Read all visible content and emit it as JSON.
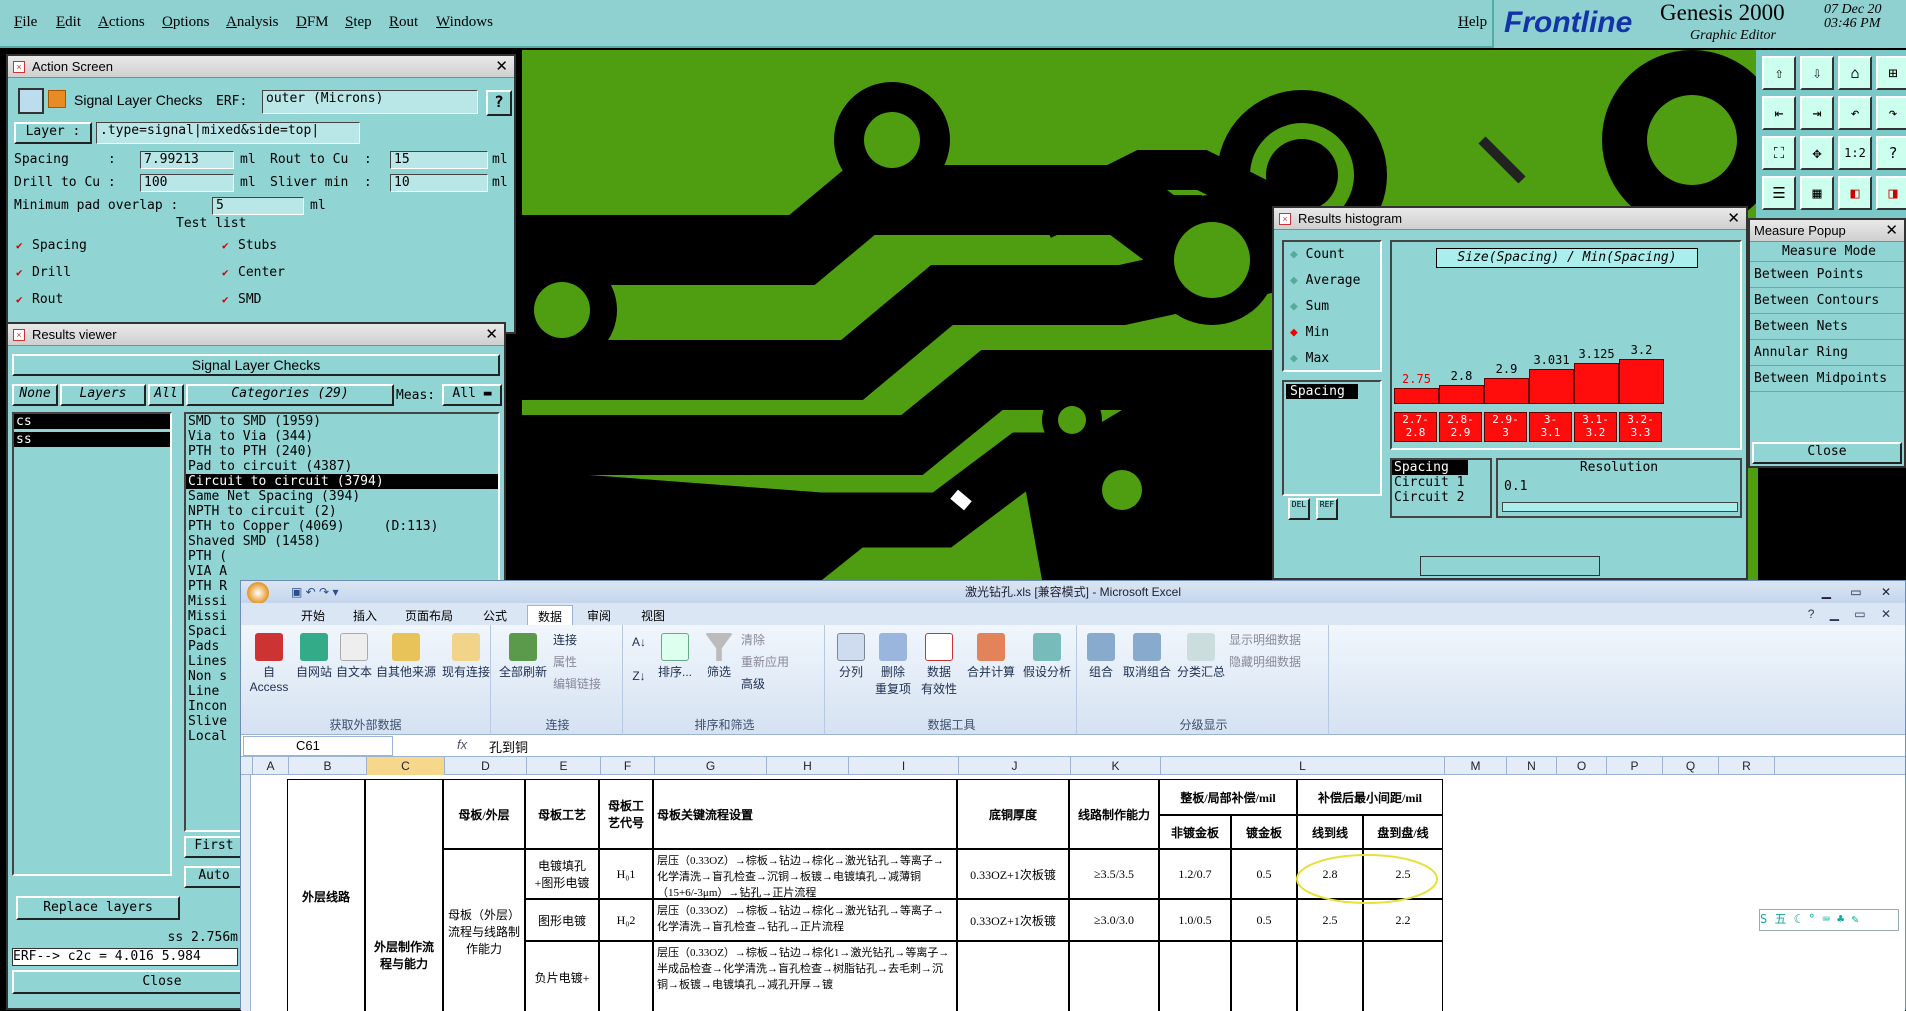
{
  "menu": [
    "File",
    "Edit",
    "Actions",
    "Options",
    "Analysis",
    "DFM",
    "Step",
    "Rout",
    "Windows"
  ],
  "help": "Help",
  "brand": {
    "logo": "Frontline",
    "product": "Genesis 2000",
    "subtitle": "Graphic Editor",
    "date": "07 Dec 20",
    "time": "03:46 PM"
  },
  "action_screen": {
    "title": "Action Screen",
    "check_name": "Signal Layer Checks",
    "erf_label": "ERF:",
    "erf_value": "outer (Microns)",
    "layer_label": "Layer :",
    "layer_value": ".type=signal|mixed&side=top|",
    "spacing_label": "Spacing     :",
    "spacing_value": "7.99213",
    "rout_label": "Rout to Cu  :",
    "rout_value": "15",
    "drill_label": "Drill to Cu :",
    "drill_value": "100",
    "sliver_label": "Sliver min  :",
    "sliver_value": "10",
    "unit": "ml",
    "minpad_label": "Minimum pad overlap :",
    "minpad_value": "5",
    "testlist_label": "Test list",
    "tests": [
      "Spacing",
      "Drill",
      "Rout",
      "Stubs",
      "Center",
      "SMD"
    ]
  },
  "results_viewer": {
    "title": "Results viewer",
    "header": "Signal Layer Checks",
    "none": "None",
    "layers": "Layers",
    "all": "All",
    "categories": "Categories (29)",
    "meas_label": "Meas:",
    "meas_value": "All",
    "layer_items": [
      "cs",
      "ss"
    ],
    "category_items": [
      "SMD to SMD (1959)",
      "Via to Via (344)",
      "PTH to PTH (240)",
      "Pad to circuit (4387)",
      "Circuit to circuit (3794)",
      "Same Net Spacing (394)",
      "NPTH to circuit (2)",
      "PTH to Copper (4069)     (D:113)",
      "Shaved SMD (1458)",
      "PTH (",
      "VIA A",
      "PTH R",
      "Missi",
      "Missi",
      "Spaci",
      "Pads",
      "Lines",
      "Non s",
      "Line",
      "Incon",
      "Slive",
      "Local"
    ],
    "replace_layers": "Replace layers",
    "first": "First",
    "auto": "Auto",
    "status1": "ss 2.756m",
    "status2": "ERF--> c2c = 4.016 5.984",
    "close": "Close"
  },
  "histogram": {
    "title": "Results histogram",
    "options": [
      "Count",
      "Average",
      "Sum",
      "Min",
      "Max"
    ],
    "selected_option": "Min",
    "metric_label": "Spacing",
    "header": "Size(Spacing) / Min(Spacing)",
    "legend": [
      "Spacing",
      "Circuit 1",
      "Circuit 2"
    ],
    "resolution_label": "Resolution",
    "resolution_value": "0.1",
    "del": "DEL",
    "ref": "REF"
  },
  "chart_data": {
    "type": "bar",
    "title": "Size(Spacing) / Min(Spacing)",
    "categories": [
      "2.7-2.8",
      "2.8-2.9",
      "2.9-3",
      "3-3.1",
      "3.1-3.2",
      "3.2-3.3"
    ],
    "values": [
      2.75,
      2.8,
      2.9,
      3.031,
      3.125,
      3.2
    ],
    "value_labels": [
      "2.75",
      "2.8",
      "2.9",
      "3.031",
      "3.125",
      "3.2"
    ],
    "range_labels": [
      [
        "2.7-",
        "2.8"
      ],
      [
        "2.8-",
        "2.9"
      ],
      [
        "2.9-",
        "3"
      ],
      [
        "3-",
        "3.1"
      ],
      [
        "3.1-",
        "3.2"
      ],
      [
        "3.2-",
        "3.3"
      ]
    ],
    "ylim": [
      2.5,
      3.3
    ]
  },
  "measure_popup": {
    "title": "Measure Popup",
    "mode": "Measure Mode",
    "items": [
      "Between Points",
      "Between Contours",
      "Between Nets",
      "Annular Ring",
      "Between Midpoints"
    ],
    "close": "Close"
  },
  "excel": {
    "title": "激光钻孔.xls [兼容模式] - Microsoft Excel",
    "tabs": [
      "开始",
      "插入",
      "页面布局",
      "公式",
      "数据",
      "审阅",
      "视图"
    ],
    "active_tab": "数据",
    "groups": [
      "获取外部数据",
      "连接",
      "排序和筛选",
      "数据工具",
      "分级显示"
    ],
    "buttons": {
      "access": "自 Access",
      "web": "自网站",
      "text": "自文本",
      "other": "自其他来源",
      "existing": "现有连接",
      "refresh": "全部刷新",
      "connections": "连接",
      "properties": "属性",
      "editlinks": "编辑链接",
      "sort": "排序...",
      "filter": "筛选",
      "clear": "清除",
      "reapply": "重新应用",
      "advanced": "高级",
      "split": "分列",
      "dedupe": "删除\n重复项",
      "validate": "数据\n有效性",
      "consolidate": "合并计算",
      "whatif": "假设分析",
      "group": "组合",
      "ungroup": "取消组合",
      "subtotal": "分类汇总",
      "show": "显示明细数据",
      "hide": "隐藏明细数据"
    },
    "namebox": "C61",
    "fx": "fx",
    "formula": "孔到铜",
    "columns": [
      "A",
      "B",
      "C",
      "D",
      "E",
      "F",
      "G",
      "H",
      "I",
      "J",
      "K",
      "L",
      "M",
      "N",
      "O",
      "P",
      "Q",
      "R"
    ],
    "headers": {
      "d": "母板/外层",
      "e": "母板工艺",
      "f": "母板工艺代号",
      "g": "母板关键流程设置",
      "j": "底铜厚度",
      "k": "线路制作能力",
      "l1": "整板/局部补偿/mil",
      "l2": "补偿后最小间距/mil",
      "sub": [
        "非镀金板",
        "镀金板",
        "线到线",
        "盘到盘/线"
      ]
    },
    "b_cell": "外层线路",
    "c_cell": "外层制作流程与能力",
    "d_cell": "母板（外层）流程与线路制作能力",
    "rows": [
      {
        "e": "电镀填孔+图形电镀",
        "f": "H₀1",
        "g": "层压（0.33OZ）→棕板→钻边→棕化→激光钻孔→等离子→化学清洗→盲孔检查→沉铜→板镀→电镀填孔→减薄铜（15+6/-3μm）→钻孔→正片流程",
        "j": "0.33OZ+1次板镀",
        "k": "≥3.5/3.5",
        "l1": "1.2/0.7",
        "l2": "0.5",
        "l3": "2.8",
        "l4": "2.5"
      },
      {
        "e": "图形电镀",
        "f": "H₀2",
        "g": "层压（0.33OZ）→棕板→钻边→棕化→激光钻孔→等离子→化学清洗→盲孔检查→钻孔→正片流程",
        "j": "0.33OZ+1次板镀",
        "k": "≥3.0/3.0",
        "l1": "1.0/0.5",
        "l2": "0.5",
        "l3": "2.5",
        "l4": "2.2"
      },
      {
        "e": "负片电镀+",
        "f": "",
        "g": "层压（0.33OZ）→棕板→钻边→棕化1→激光钻孔→等离子→半成品检查→化学清洗→盲孔检查→树脂钻孔→去毛刺→沉铜→板镀→电镀填孔→减孔开厚→镀",
        "j": "",
        "k": "",
        "l1": "",
        "l2": "",
        "l3": "",
        "l4": ""
      }
    ],
    "ime": "五"
  },
  "colors": {
    "panel": "#90d4d4",
    "board": "#4f9e12",
    "bar": "#ff0d0d"
  }
}
